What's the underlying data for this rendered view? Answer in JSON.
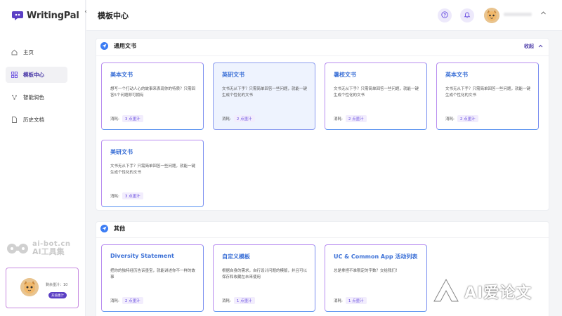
{
  "app": {
    "brand": "WritingPal"
  },
  "sidebar": {
    "items": [
      {
        "label": "主页",
        "icon": "home-icon",
        "active": false
      },
      {
        "label": "模板中心",
        "icon": "grid-icon",
        "active": true
      },
      {
        "label": "智能润色",
        "icon": "sparkle-icon",
        "active": false
      },
      {
        "label": "历史文档",
        "icon": "document-icon",
        "active": false
      }
    ],
    "watermark": {
      "line1": "ai-bot.cn",
      "line2": "AI工具集"
    },
    "promo": {
      "text": "剩余墨汁：10",
      "button": "充值墨汁"
    }
  },
  "header": {
    "title": "模板中心"
  },
  "sections": [
    {
      "title": "通用文书",
      "collapse_label": "收起",
      "cards": [
        {
          "title": "美本文书",
          "desc": "想写一个打动人心的故事来表现你的特质？只需回答5个问题即可拥有",
          "cost_label": "消耗:",
          "cost": "3 点墨汁",
          "selected": false
        },
        {
          "title": "英研文书",
          "desc": "文书无从下手？只需简单回答一些问题，就能一键生成个性化的文书",
          "cost_label": "消耗:",
          "cost": "2 点墨汁",
          "selected": true
        },
        {
          "title": "暑校文书",
          "desc": "文书无从下手？只需简单回答一些问题，就能一键生成个性化的文书",
          "cost_label": "消耗:",
          "cost": "2 点墨汁",
          "selected": false
        },
        {
          "title": "英本文书",
          "desc": "文书无从下手？只需简单回答一些问题，就能一键生成个性化的文书",
          "cost_label": "消耗:",
          "cost": "2 点墨汁",
          "selected": false
        },
        {
          "title": "美研文书",
          "desc": "文书无从下手？只需简单回答一些问题，就能一键生成个性化的文书",
          "cost_label": "消耗:",
          "cost": "3 点墨汁",
          "selected": false
        }
      ]
    },
    {
      "title": "其他",
      "cards": [
        {
          "title": "Diversity Statement",
          "desc": "把你的独特经历告诉墨宝，就能讲述你不一样的故事",
          "cost_label": "消耗:",
          "cost": "2 点墨汁",
          "selected": false
        },
        {
          "title": "自定义模板",
          "desc": "根据自身的需求，自行设计问题的模版，并且可以保存和收藏在未来使用",
          "cost_label": "消耗:",
          "cost": "1 点墨汁",
          "selected": false
        },
        {
          "title": "UC & Common App 活动列表",
          "desc": "总是拿捏不准限定的字数？交给我们！",
          "cost_label": "消耗:",
          "cost": "1 点墨汁",
          "selected": false
        }
      ]
    }
  ],
  "watermark_right": "AI爱论文",
  "colors": {
    "accent": "#6a4fe0",
    "title_blue": "#3a6fd6",
    "section_icon": "#3b7cf4"
  }
}
